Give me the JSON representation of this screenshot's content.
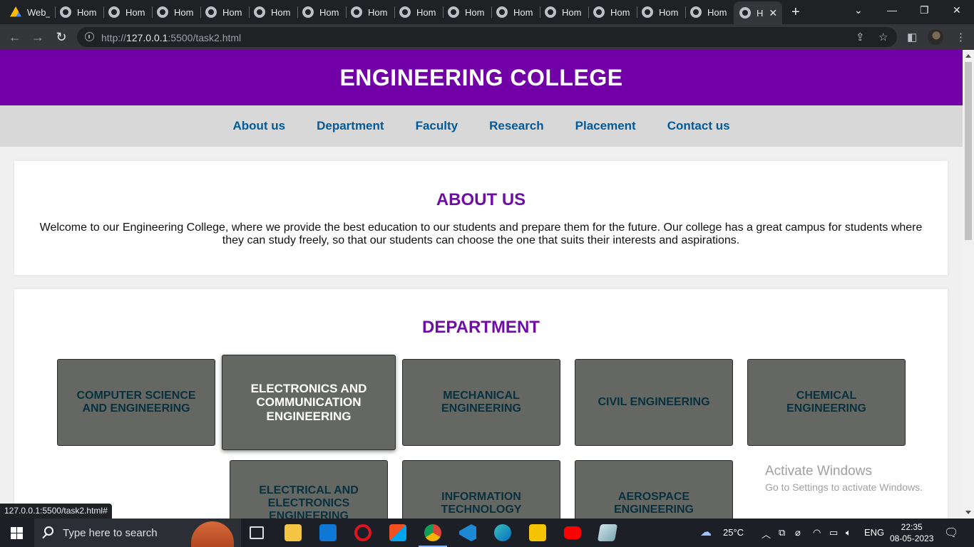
{
  "browser": {
    "tabs": [
      {
        "title": "Web_",
        "icon": "google-drive-icon"
      },
      {
        "title": "Hom",
        "icon": "globe-icon"
      },
      {
        "title": "Hom",
        "icon": "globe-icon"
      },
      {
        "title": "Hom",
        "icon": "globe-icon"
      },
      {
        "title": "Hom",
        "icon": "globe-icon"
      },
      {
        "title": "Hom",
        "icon": "globe-icon"
      },
      {
        "title": "Hom",
        "icon": "globe-icon"
      },
      {
        "title": "Hom",
        "icon": "globe-icon"
      },
      {
        "title": "Hom",
        "icon": "globe-icon"
      },
      {
        "title": "Hom",
        "icon": "globe-icon"
      },
      {
        "title": "Hom",
        "icon": "globe-icon"
      },
      {
        "title": "Hom",
        "icon": "globe-icon"
      },
      {
        "title": "Hom",
        "icon": "globe-icon"
      },
      {
        "title": "Hom",
        "icon": "globe-icon"
      },
      {
        "title": "Hom",
        "icon": "globe-icon"
      },
      {
        "title": "H",
        "icon": "globe-icon",
        "active": true
      }
    ],
    "new_tab": "+",
    "url_prefix": "http://",
    "url_host": "127.0.0.1",
    "url_rest": ":5500/task2.html",
    "status_url": "127.0.0.1:5500/task2.html#"
  },
  "site": {
    "title": "ENGINEERING COLLEGE",
    "nav": [
      "About us",
      "Department",
      "Faculty",
      "Research",
      "Placement",
      "Contact us"
    ],
    "about": {
      "heading": "ABOUT US",
      "text": "Welcome to our Engineering College, where we provide the best education to our students and prepare them for the future. Our college has a great campus for students where they can study freely, so that our students can choose the one that suits their interests and aspirations."
    },
    "department": {
      "heading": "DEPARTMENT",
      "items": [
        "COMPUTER SCIENCE AND ENGINEERING",
        "ELECTRONICS AND COMMUNICATION ENGINEERING",
        "MECHANICAL ENGINEERING",
        "CIVIL ENGINEERING",
        "CHEMICAL ENGINEERING",
        "ELECTRICAL AND ELECTRONICS ENGINEERING",
        "INFORMATION TECHNOLOGY",
        "AEROSPACE ENGINEERING"
      ]
    },
    "colors": {
      "header": "#7100a6",
      "heading": "#6f0ea6",
      "nav_link": "#005a9c",
      "dept_box": "#656862"
    }
  },
  "watermark": {
    "line1": "Activate Windows",
    "line2": "Go to Settings to activate Windows."
  },
  "taskbar": {
    "search_placeholder": "Type here to search",
    "weather": "25°C",
    "language": "ENG",
    "time": "22:35",
    "date": "08-05-2023"
  }
}
